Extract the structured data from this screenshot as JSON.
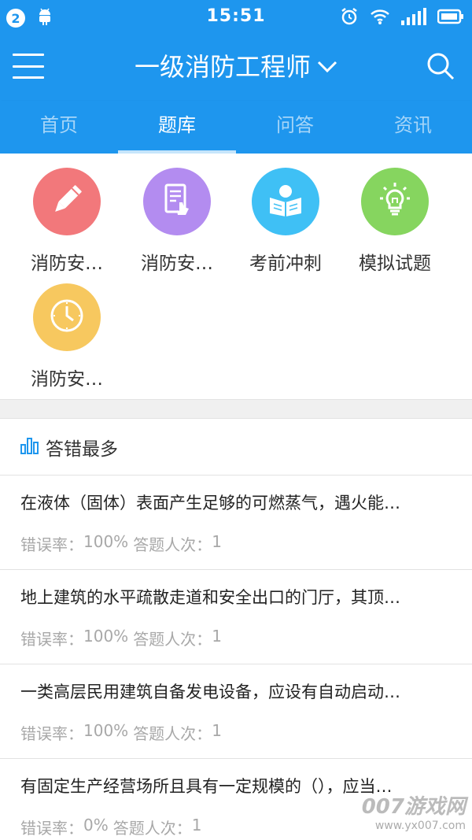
{
  "status_bar": {
    "notification_count": "2",
    "time": "15:51",
    "icons": [
      "android-icon",
      "alarm-icon",
      "wifi-icon",
      "signal-icon",
      "battery-icon"
    ]
  },
  "app_bar": {
    "title": "一级消防工程师",
    "icons": [
      "menu-icon",
      "chevron-down-icon",
      "search-icon"
    ]
  },
  "tabs": [
    {
      "label": "首页",
      "active": false
    },
    {
      "label": "题库",
      "active": true
    },
    {
      "label": "问答",
      "active": false
    },
    {
      "label": "资讯",
      "active": false
    }
  ],
  "categories": [
    {
      "label": "消防安…",
      "icon": "pencil-icon",
      "color": "#f2787b"
    },
    {
      "label": "消防安…",
      "icon": "document-tap-icon",
      "color": "#b38cf0"
    },
    {
      "label": "考前冲刺",
      "icon": "open-book-icon",
      "color": "#3fc0f5"
    },
    {
      "label": "模拟试题",
      "icon": "lightbulb-icon",
      "color": "#86d55f"
    },
    {
      "label": "消防安…",
      "icon": "clock-icon",
      "color": "#f7c85f"
    }
  ],
  "section": {
    "title": "答错最多",
    "icon": "bar-chart-icon"
  },
  "questions": [
    {
      "text": "在液体（固体）表面产生足够的可燃蒸气，遇火能…",
      "error_label": "错误率：",
      "error_rate": "100%",
      "count_label": "答题人次：",
      "count": "1"
    },
    {
      "text": "地上建筑的水平疏散走道和安全出口的门厅，其顶…",
      "error_label": "错误率：",
      "error_rate": "100%",
      "count_label": "答题人次：",
      "count": "1"
    },
    {
      "text": "一类高层民用建筑自备发电设备，应设有自动启动…",
      "error_label": "错误率：",
      "error_rate": "100%",
      "count_label": "答题人次：",
      "count": "1"
    },
    {
      "text": "有固定生产经营场所且具有一定规模的（），应当…",
      "error_label": "错误率：",
      "error_rate": "0%",
      "count_label": "答题人次：",
      "count": "1"
    }
  ],
  "watermark": {
    "brand": "007游戏网",
    "url": "www.yx007.com"
  },
  "colors": {
    "primary": "#1e96ee"
  }
}
